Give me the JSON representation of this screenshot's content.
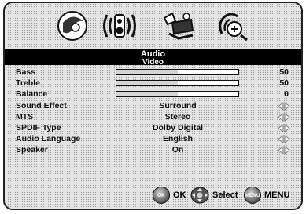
{
  "menu": {
    "title": "Audio",
    "subtitle_overlap": "Video"
  },
  "rows": [
    {
      "label": "Bass",
      "type": "slider",
      "value": "50",
      "level": 0.5
    },
    {
      "label": "Treble",
      "type": "slider",
      "value": "50",
      "level": 0.5
    },
    {
      "label": "Balance",
      "type": "slider",
      "value": "0",
      "level": 0.5
    },
    {
      "label": "Sound Effect",
      "type": "option",
      "value": "Surround"
    },
    {
      "label": "MTS",
      "type": "option",
      "value": "Stereo"
    },
    {
      "label": "SPDIF Type",
      "type": "option",
      "value": "Dolby Digital"
    },
    {
      "label": "Audio Language",
      "type": "option",
      "value": "English"
    },
    {
      "label": "Speaker",
      "type": "option",
      "value": "On"
    }
  ],
  "footer": {
    "ok_badge": "OK",
    "ok_label": "OK",
    "select_label": "Select",
    "menu_badge": "MENU",
    "menu_label": "MENU"
  },
  "icons": [
    "picture-tab-icon",
    "audio-tab-icon",
    "setup-tab-icon",
    "channel-tab-icon"
  ]
}
